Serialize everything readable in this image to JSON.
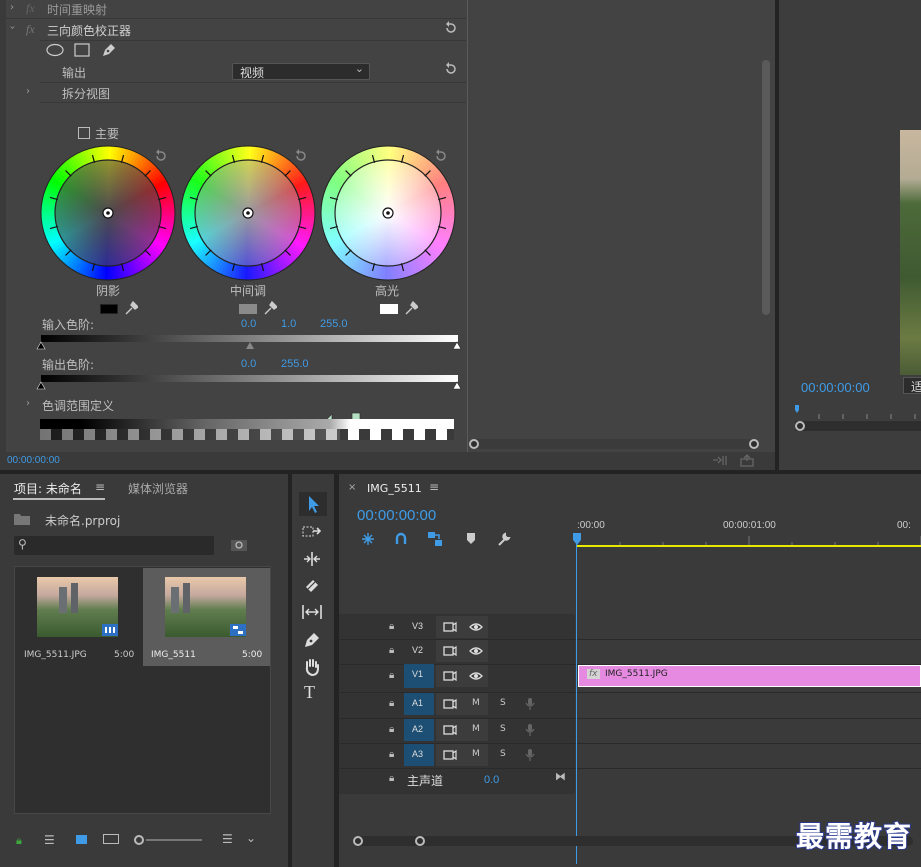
{
  "effect_controls": {
    "row_time_remap": "时间重映射",
    "fx_label": "fx",
    "effect_name": "三向颜色校正器",
    "output_label": "输出",
    "output_value": "视频",
    "split_view_label": "拆分视图",
    "master_label": "主要",
    "wheels": [
      {
        "label": "阴影",
        "swatch": "#000000"
      },
      {
        "label": "中间调",
        "swatch": "#8a8a8a"
      },
      {
        "label": "高光",
        "swatch": "#ffffff"
      }
    ],
    "input_levels_label": "输入色阶:",
    "input_levels_values": [
      "0.0",
      "1.0",
      "255.0"
    ],
    "output_levels_label": "输出色阶:",
    "output_levels_values": [
      "0.0",
      "255.0"
    ],
    "tonal_range_label": "色调范围定义",
    "timecode": "00:00:00:00"
  },
  "program_monitor": {
    "timecode": "00:00:00:00",
    "fit_label": "适"
  },
  "project_panel": {
    "tab_project": "项目: 未命名",
    "tab_media": "媒体浏览器",
    "project_file": "未命名.prproj",
    "search_placeholder": "",
    "items": [
      {
        "name": "IMG_5511.JPG",
        "duration": "5:00"
      },
      {
        "name": "IMG_5511",
        "duration": "5:00"
      }
    ]
  },
  "timeline": {
    "tab_name": "IMG_5511",
    "timecode": "00:00:00:00",
    "ruler_labels": [
      ":00:00",
      "00:00:01:00",
      "00:"
    ],
    "tracks_video": [
      "V3",
      "V2",
      "V1"
    ],
    "tracks_audio": [
      "A1",
      "A2",
      "A3"
    ],
    "mute_label": "M",
    "solo_label": "S",
    "master_label": "主声道",
    "master_value": "0.0",
    "clip_label": "IMG_5511.JPG",
    "clip_fx": "fx"
  },
  "watermark": "最需教育",
  "colors": {
    "accent": "#3f9be6",
    "clip": "#e58ae0",
    "work_area": "#e8e800",
    "selected_track": "#1d4f74"
  }
}
